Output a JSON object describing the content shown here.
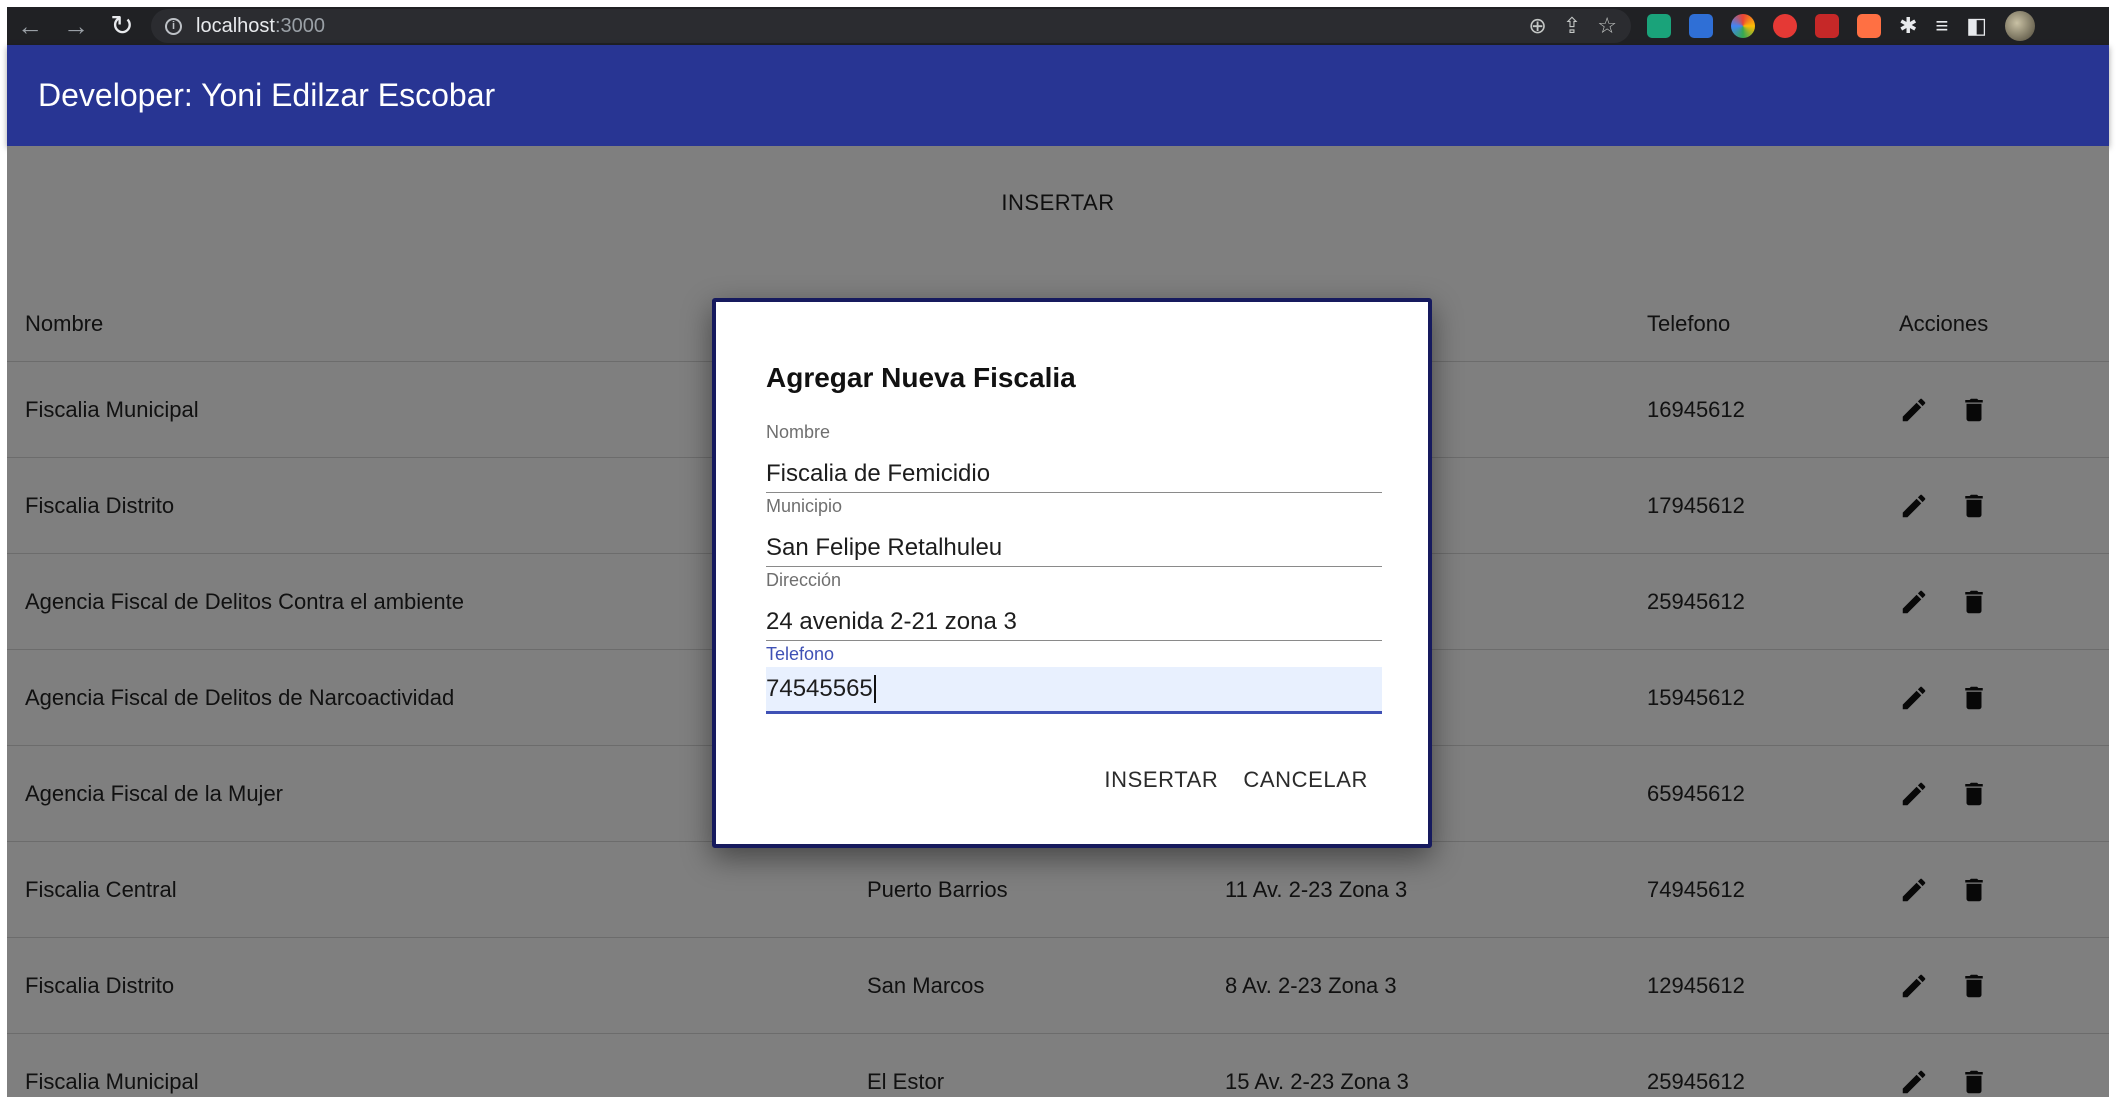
{
  "browser": {
    "url_host": "localhost",
    "url_port": ":3000",
    "back_icon": "arrow-left-icon",
    "forward_icon": "arrow-right-icon",
    "reload_icon": "reload-icon"
  },
  "appbar": {
    "title": "Developer: Yoni Edilzar Escobar"
  },
  "page": {
    "insert_button": "INSERTAR"
  },
  "table": {
    "headers": {
      "nombre": "Nombre",
      "telefono": "Telefono",
      "acciones": "Acciones"
    },
    "rows": [
      {
        "nombre": "Fiscalia Municipal",
        "municipio": "",
        "direccion": "",
        "telefono": "16945612"
      },
      {
        "nombre": "Fiscalia Distrito",
        "municipio": "",
        "direccion": "",
        "telefono": "17945612"
      },
      {
        "nombre": "Agencia Fiscal de Delitos Contra el ambiente",
        "municipio": "",
        "direccion": "",
        "telefono": "25945612"
      },
      {
        "nombre": "Agencia Fiscal de Delitos de Narcoactividad",
        "municipio": "",
        "direccion": "",
        "telefono": "15945612"
      },
      {
        "nombre": "Agencia Fiscal de la Mujer",
        "municipio": "",
        "direccion": "",
        "telefono": "65945612"
      },
      {
        "nombre": "Fiscalia Central",
        "municipio": "Puerto Barrios",
        "direccion": "11 Av. 2-23 Zona 3",
        "telefono": "74945612"
      },
      {
        "nombre": "Fiscalia Distrito",
        "municipio": "San Marcos",
        "direccion": "8 Av. 2-23 Zona 3",
        "telefono": "12945612"
      },
      {
        "nombre": "Fiscalia Municipal",
        "municipio": "El Estor",
        "direccion": "15 Av. 2-23 Zona 3",
        "telefono": "25945612"
      }
    ]
  },
  "dialog": {
    "title": "Agregar Nueva Fiscalia",
    "fields": {
      "nombre": {
        "label": "Nombre",
        "value": "Fiscalia de Femicidio"
      },
      "municipio": {
        "label": "Municipio",
        "value": "San Felipe Retalhuleu"
      },
      "direccion": {
        "label": "Dirección",
        "value": "24 avenida 2-21 zona 3"
      },
      "telefono": {
        "label": "Telefono",
        "value": "74545565"
      }
    },
    "insert_label": "INSERTAR",
    "cancel_label": "CANCELAR"
  },
  "colors": {
    "appbar": "#283593",
    "accent": "#3f51b5",
    "dialog_border": "#161a5e"
  }
}
